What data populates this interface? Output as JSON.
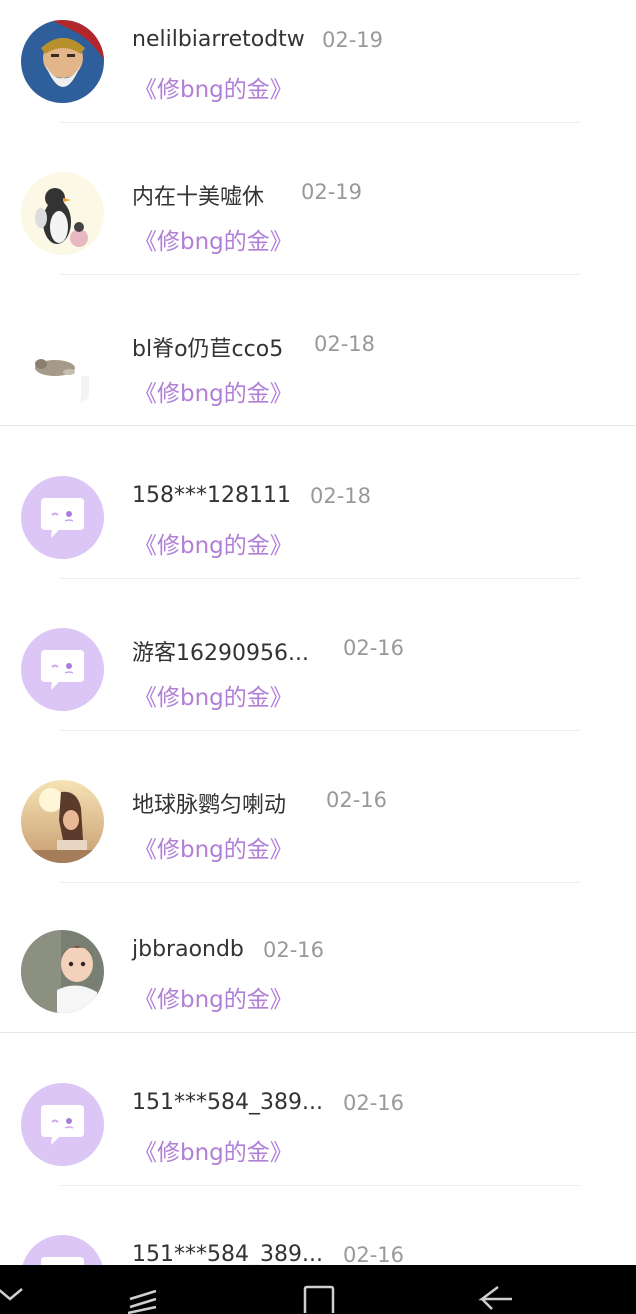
{
  "comments": [
    {
      "name": "nelilbiarretodtw",
      "date": "02-19",
      "book": "《修bng的金》",
      "avatar": "avatar-warrior-icon"
    },
    {
      "name": "内在十美嘘休",
      "date": "02-19",
      "book": "《修bng的金》",
      "avatar": "avatar-penguin-icon"
    },
    {
      "name": "bl脊o仍苣cco5",
      "date": "02-18",
      "book": "《修bng的金》",
      "avatar": "avatar-animal-icon"
    },
    {
      "name": "158***128111",
      "date": "02-18",
      "book": "《修bng的金》",
      "avatar": "default-avatar-chat-icon"
    },
    {
      "name": "游客16290956...",
      "date": "02-16",
      "book": "《修bng的金》",
      "avatar": "default-avatar-chat-icon"
    },
    {
      "name": "地球脉鹦匀喇动",
      "date": "02-16",
      "book": "《修bng的金》",
      "avatar": "avatar-photo-icon"
    },
    {
      "name": "jbbraondb",
      "date": "02-16",
      "book": "《修bng的金》",
      "avatar": "avatar-baby-photo-icon"
    },
    {
      "name": "151***584_389...",
      "date": "02-16",
      "book": "《修bng的金》",
      "avatar": "default-avatar-chat-icon"
    },
    {
      "name": "151***584_389...",
      "date": "02-16",
      "book": "",
      "avatar": "default-avatar-chat-icon"
    }
  ],
  "navbar": {
    "buttons": [
      "chevron-down-icon",
      "recent-apps-icon",
      "home-icon",
      "back-icon"
    ]
  },
  "colors": {
    "accent_purple": "#b07fd6",
    "default_avatar_bg": "#dcc6f6",
    "name_text": "#333333",
    "date_text": "#999999"
  }
}
